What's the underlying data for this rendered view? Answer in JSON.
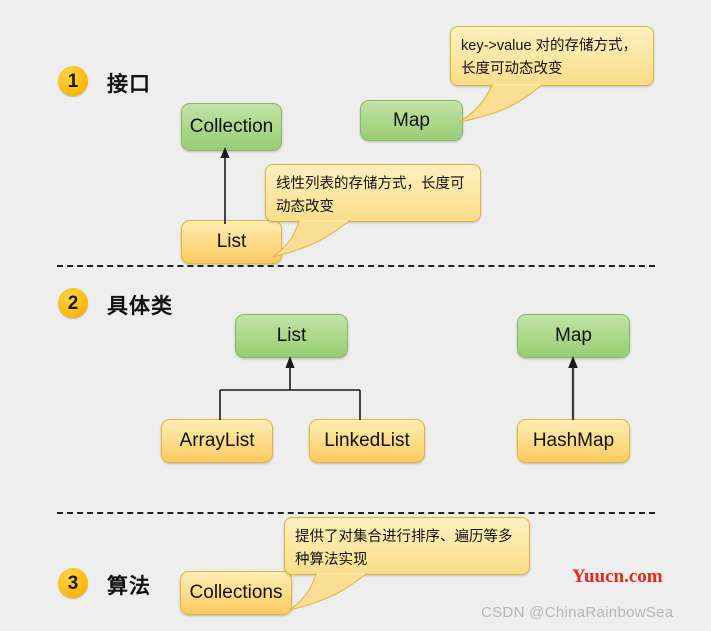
{
  "background_color": "#eeeeee",
  "palette": {
    "interface_node": "#aed98d",
    "class_node": "#fcdd8c",
    "callout": "#fce7a2",
    "badge": "#fdbe12",
    "connector": "#1a1a1a",
    "divider": "#222222",
    "watermark_red": "#e8261b",
    "watermark_gray": "#b6b6b6"
  },
  "sections": [
    {
      "number": "1",
      "title": "接口"
    },
    {
      "number": "2",
      "title": "具体类"
    },
    {
      "number": "3",
      "title": "算法"
    }
  ],
  "nodes": {
    "collection": "Collection",
    "map_interface": "Map",
    "list_interface": "List",
    "list_class": "List",
    "map_class": "Map",
    "arraylist": "ArrayList",
    "linkedlist": "LinkedList",
    "hashmap": "HashMap",
    "collections": "Collections"
  },
  "callouts": {
    "map_note": "key->value 对的存储方式，长度可动态改变",
    "list_note": "线性列表的存储方式，长度可动态改变",
    "collections_note": "提供了对集合进行排序、遍历等多种算法实现"
  },
  "watermarks": {
    "site": "Yuucn.com",
    "author": "CSDN @ChinaRainbowSea"
  }
}
